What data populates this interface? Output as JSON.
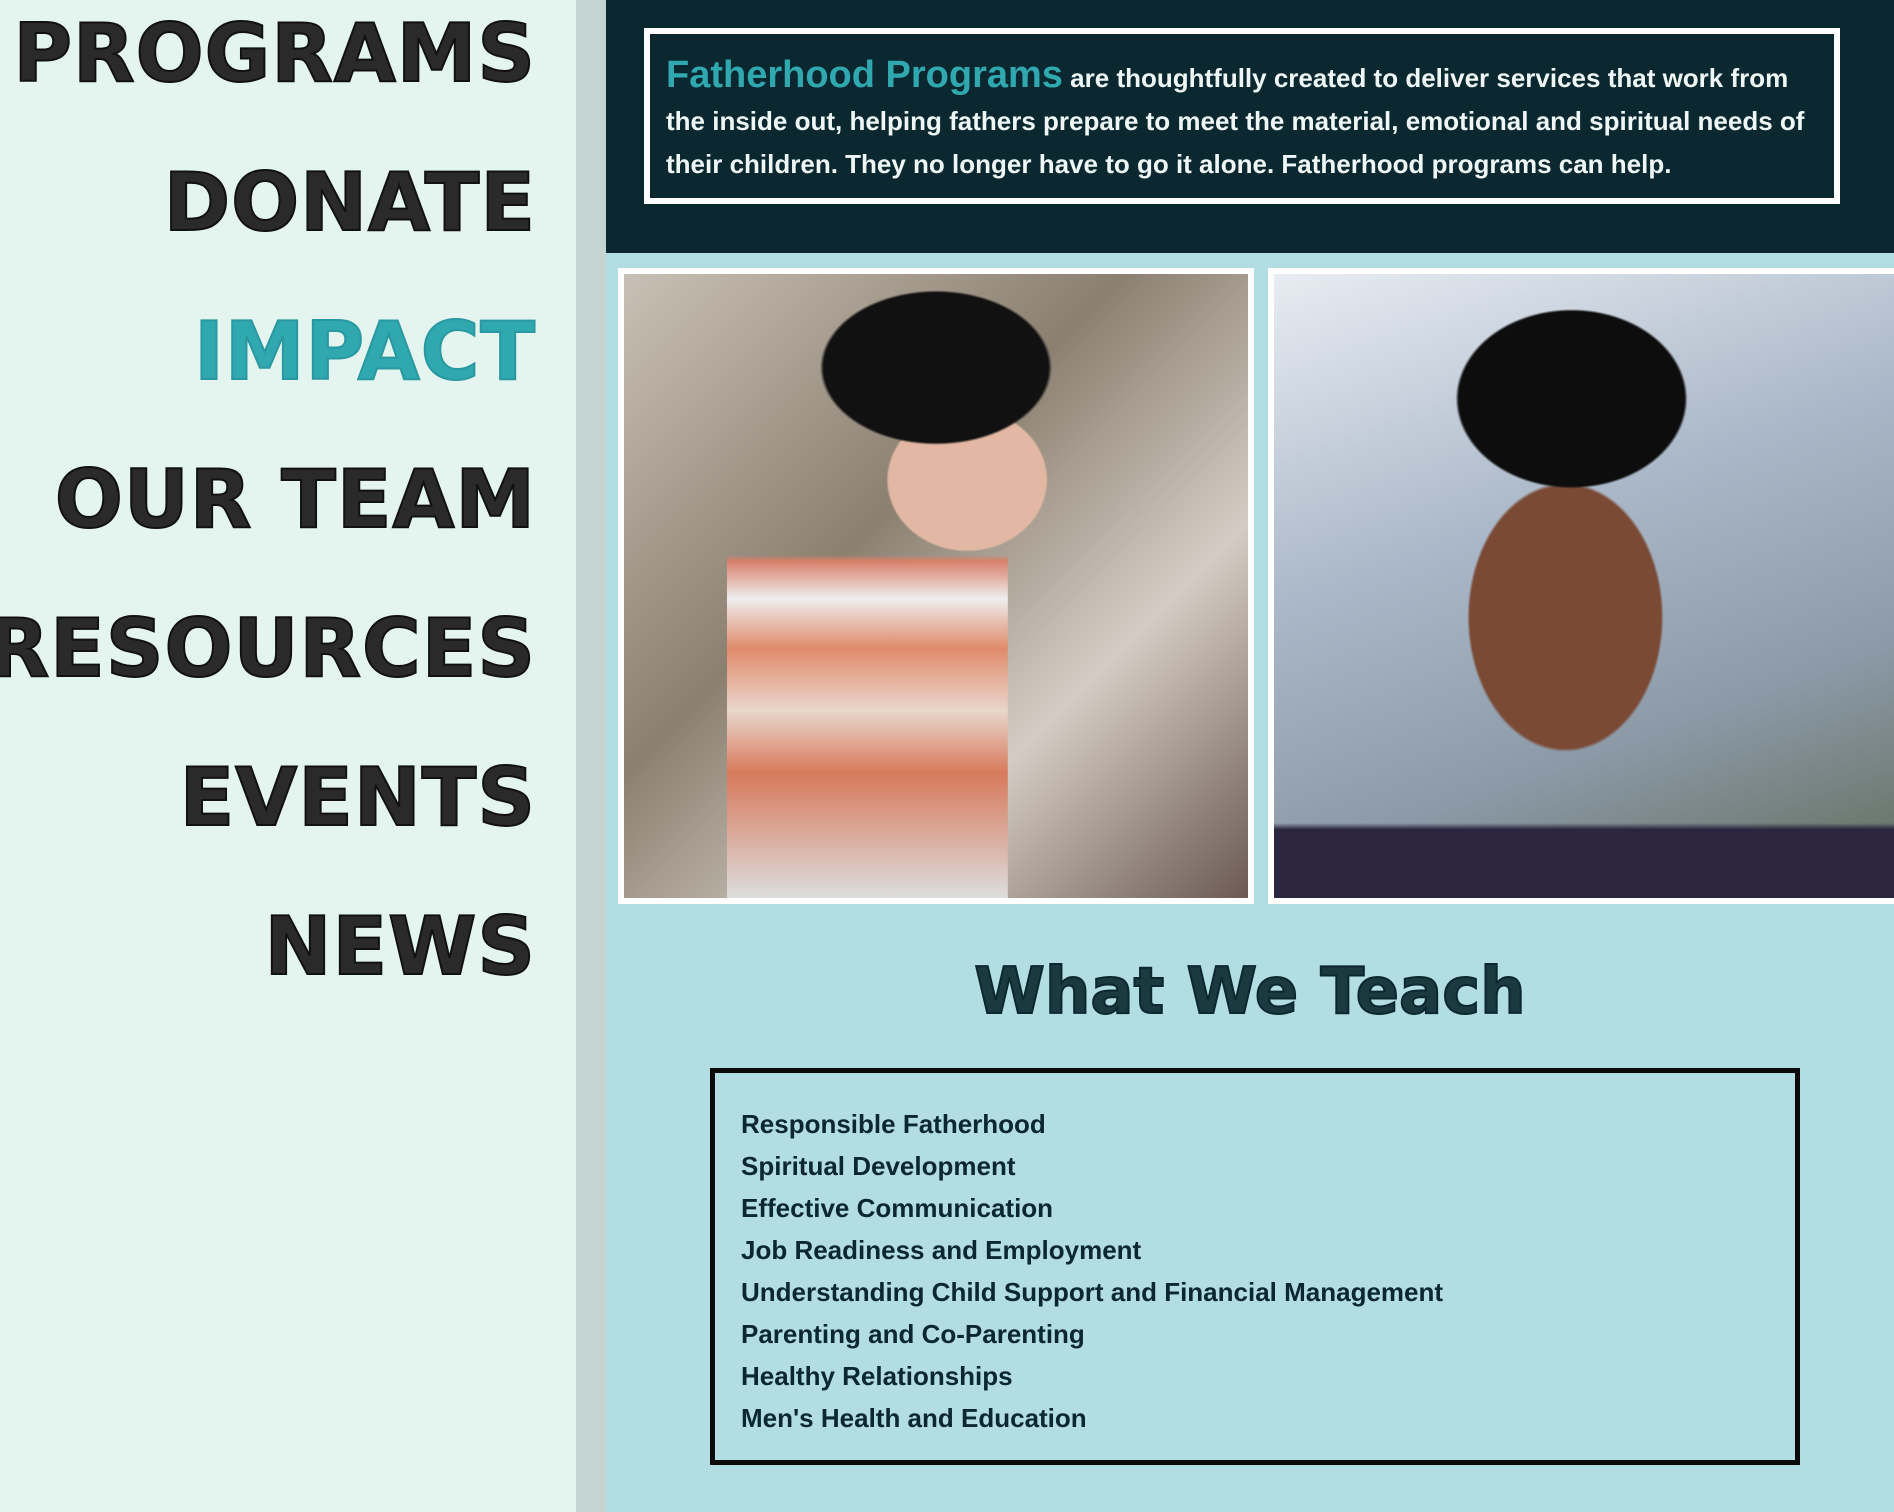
{
  "nav": {
    "items": [
      {
        "label": "PROGRAMS",
        "active": false
      },
      {
        "label": "DONATE",
        "active": false
      },
      {
        "label": "IMPACT",
        "active": true
      },
      {
        "label": "OUR TEAM",
        "active": false
      },
      {
        "label": "RESOURCES",
        "active": false
      },
      {
        "label": "EVENTS",
        "active": false
      },
      {
        "label": "NEWS",
        "active": false
      }
    ]
  },
  "intro": {
    "highlight": "Fatherhood Programs",
    "text": " are thoughtfully created to deliver services that work from the inside out, helping fathers prepare to meet the material, emotional and spiritual needs of their children. They no longer have to go it alone. Fatherhood programs can help."
  },
  "teach": {
    "title": "What We Teach",
    "items": [
      "Responsible Fatherhood",
      "Spiritual Development",
      "Effective Communication",
      "Job Readiness and Employment",
      "Understanding Child Support and Financial Management",
      "Parenting and Co-Parenting",
      "Healthy Relationships",
      "Men's Health and Education"
    ]
  },
  "colors": {
    "accent": "#2fa8b0",
    "header_bg": "#0b2730",
    "sidebar_bg": "#e4f5f0",
    "content_bg": "#b2dde2"
  }
}
